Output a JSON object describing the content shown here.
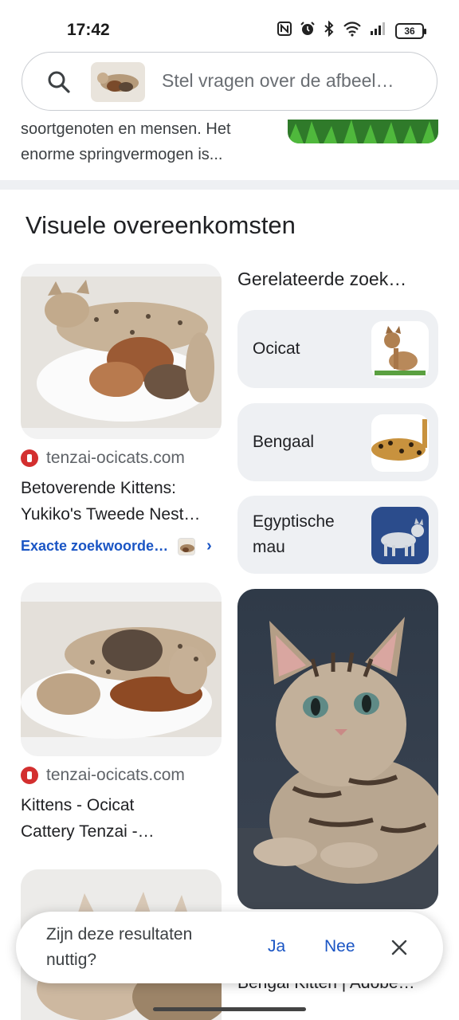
{
  "status_bar": {
    "time": "17:42",
    "battery": "36",
    "icons": [
      "nfc-icon",
      "alarm-icon",
      "bluetooth-icon",
      "wifi-icon",
      "signal-icon",
      "battery-icon"
    ]
  },
  "search": {
    "placeholder": "Stel vragen over de afbeel…"
  },
  "snippet": {
    "text_line1": "soortgenoten en mensen. Het",
    "text_line2": "enorme springvermogen is..."
  },
  "section": {
    "title": "Visuele overeenkomsten"
  },
  "results": [
    {
      "source": "tenzai-ocicats.com",
      "title_line1": "Betoverende Kittens:",
      "title_line2": "Yukiko's Tweede Nest…",
      "exact_link": "Exacte zoekwoorde…"
    },
    {
      "source": "tenzai-ocicats.com",
      "title_line1": "Kittens - Ocicat",
      "title_line2": "Cattery Tenzai -…"
    }
  ],
  "related": {
    "title": "Gerelateerde zoek…",
    "chips": [
      {
        "label": "Ocicat"
      },
      {
        "label": "Bengaal"
      },
      {
        "label_line1": "Egyptische",
        "label_line2": "mau"
      }
    ]
  },
  "bottom_caption": "Bengal Kitten | Adobe…",
  "feedback": {
    "question_line1": "Zijn deze resultaten",
    "question_line2": "nuttig?",
    "yes": "Ja",
    "no": "Nee"
  },
  "colors": {
    "accent": "#1a55c4",
    "chip_bg": "#eef0f3",
    "divider": "#eef0f3"
  }
}
